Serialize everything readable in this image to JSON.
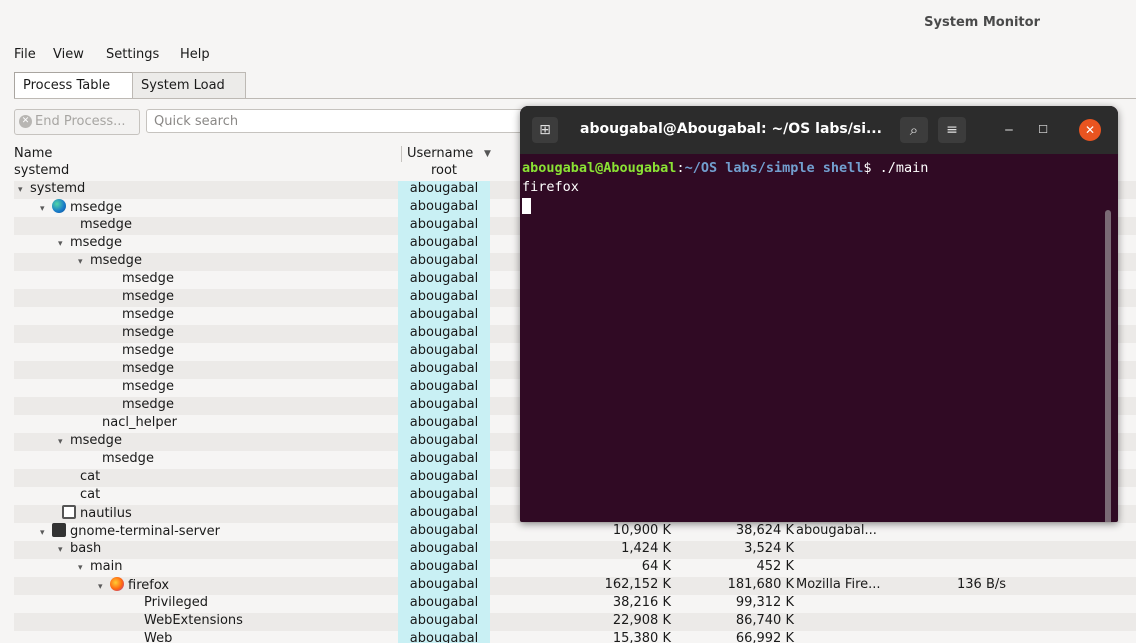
{
  "window": {
    "title": "System Monitor"
  },
  "menu": {
    "file": "File",
    "view": "View",
    "settings": "Settings",
    "help": "Help"
  },
  "tabs": {
    "process_table": "Process Table",
    "system_load": "System Load"
  },
  "toolbar": {
    "end_process": "End Process...",
    "search_placeholder": "Quick search"
  },
  "table": {
    "headers": {
      "name": "Name",
      "username": "Username"
    },
    "rows": [
      {
        "name": "systemd",
        "user": "root"
      },
      {
        "name": "systemd",
        "user": "abougabal"
      },
      {
        "name": "msedge",
        "user": "abougabal"
      },
      {
        "name": "msedge",
        "user": "abougabal"
      },
      {
        "name": "msedge",
        "user": "abougabal"
      },
      {
        "name": "msedge",
        "user": "abougabal"
      },
      {
        "name": "msedge",
        "user": "abougabal"
      },
      {
        "name": "msedge",
        "user": "abougabal"
      },
      {
        "name": "msedge",
        "user": "abougabal"
      },
      {
        "name": "msedge",
        "user": "abougabal"
      },
      {
        "name": "msedge",
        "user": "abougabal"
      },
      {
        "name": "msedge",
        "user": "abougabal"
      },
      {
        "name": "msedge",
        "user": "abougabal"
      },
      {
        "name": "msedge",
        "user": "abougabal"
      },
      {
        "name": "nacl_helper",
        "user": "abougabal"
      },
      {
        "name": "msedge",
        "user": "abougabal"
      },
      {
        "name": "msedge",
        "user": "abougabal"
      },
      {
        "name": "cat",
        "user": "abougabal"
      },
      {
        "name": "cat",
        "user": "abougabal"
      },
      {
        "name": "nautilus",
        "user": "abougabal"
      },
      {
        "name": "gnome-terminal-server",
        "user": "abougabal",
        "mem": "10,900 K",
        "res": "38,624 K",
        "desc": "abougabal..."
      },
      {
        "name": "bash",
        "user": "abougabal",
        "mem": "1,424 K",
        "res": "3,524 K"
      },
      {
        "name": "main",
        "user": "abougabal",
        "mem": "64 K",
        "res": "452 K"
      },
      {
        "name": "firefox",
        "user": "abougabal",
        "mem": "162,152 K",
        "res": "181,680 K",
        "desc": "Mozilla Fire...",
        "net": "136 B/s"
      },
      {
        "name": "Privileged",
        "user": "abougabal",
        "mem": "38,216 K",
        "res": "99,312 K"
      },
      {
        "name": "WebExtensions",
        "user": "abougabal",
        "mem": "22,908 K",
        "res": "86,740 K"
      },
      {
        "name": "Web",
        "user": "abougabal",
        "mem": "15,380 K",
        "res": "66,992 K"
      }
    ]
  },
  "terminal": {
    "title": "abougabal@Abougabal: ~/OS labs/si...",
    "prompt_user": "abougabal@Abougabal",
    "prompt_sep": ":",
    "prompt_path": "~/OS labs/simple shell",
    "prompt_end": "$ ./main",
    "output": "firefox"
  }
}
